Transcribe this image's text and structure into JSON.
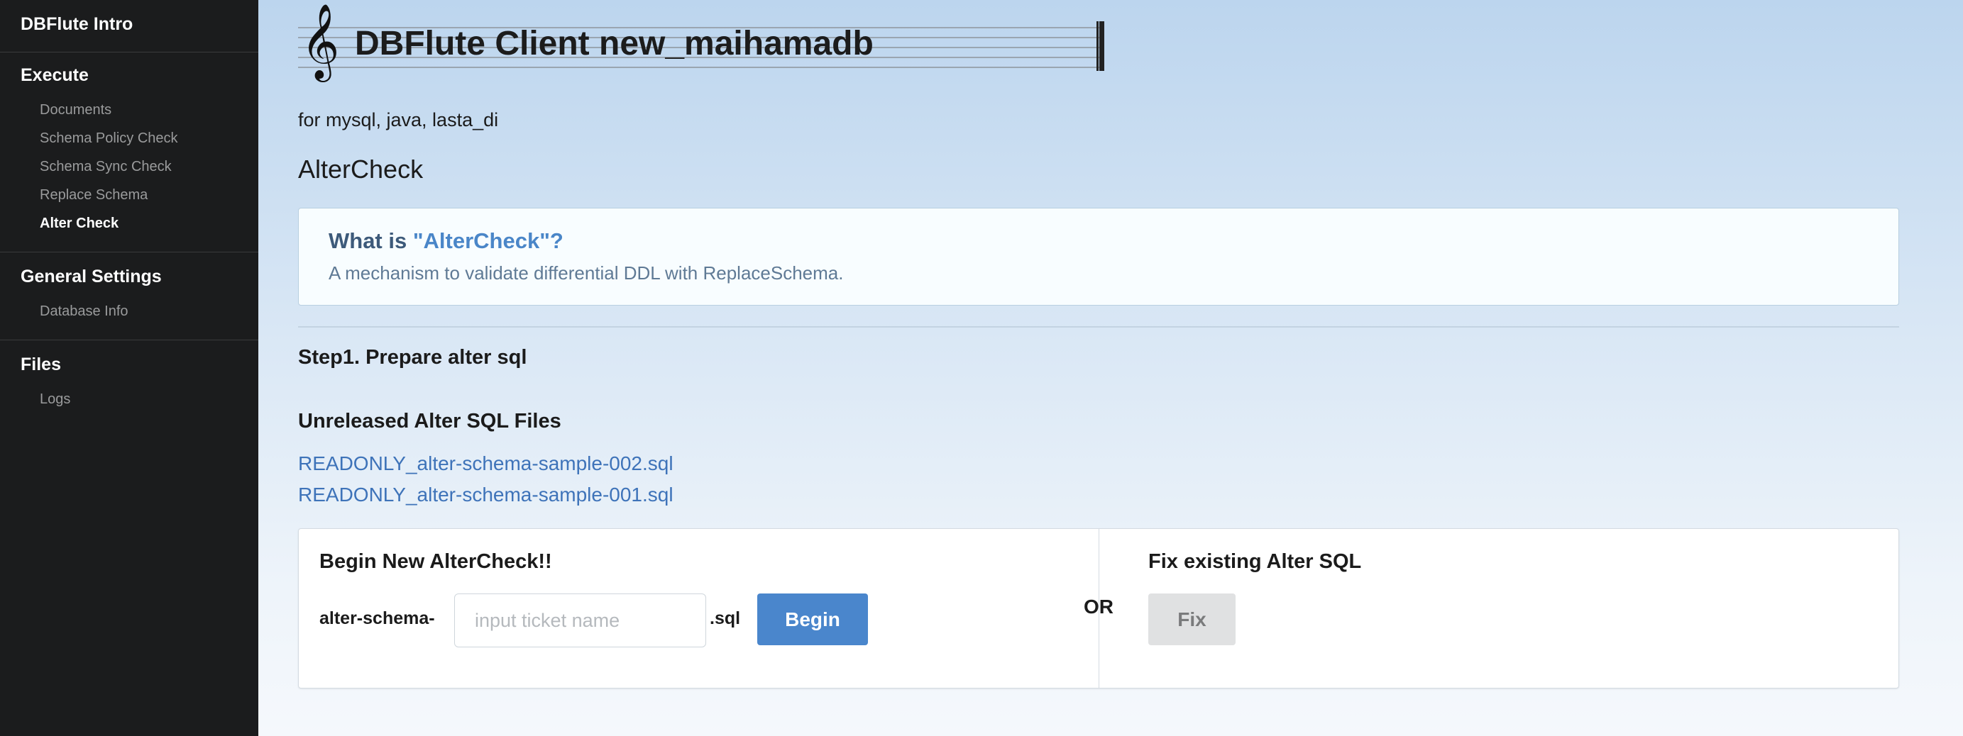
{
  "sidebar": {
    "title": "DBFlute Intro",
    "sections": [
      {
        "heading": "Execute",
        "items": [
          "Documents",
          "Schema Policy Check",
          "Schema Sync Check",
          "Replace Schema",
          "Alter Check"
        ]
      },
      {
        "heading": "General Settings",
        "items": [
          "Database Info"
        ]
      },
      {
        "heading": "Files",
        "items": [
          "Logs"
        ]
      }
    ],
    "active_item": "Alter Check"
  },
  "header": {
    "clef_icon": "treble-clef-icon",
    "title": "DBFlute Client new_maihamadb",
    "subtitle": "for mysql, java, lasta_di"
  },
  "main": {
    "section_title": "AlterCheck",
    "info": {
      "question_prefix": "What is ",
      "question_keyword": "\"AlterCheck\"?",
      "description": "A mechanism to validate differential DDL with ReplaceSchema."
    },
    "step_title": "Step1. Prepare alter sql",
    "files_title": "Unreleased Alter SQL Files",
    "files": [
      "READONLY_alter-schema-sample-002.sql",
      "READONLY_alter-schema-sample-001.sql"
    ],
    "begin": {
      "title": "Begin New AlterCheck!!",
      "prefix": "alter-schema-",
      "input_placeholder": "input ticket name",
      "input_value": "",
      "suffix": ".sql",
      "button_label": "Begin"
    },
    "or_label": "OR",
    "fix": {
      "title": "Fix existing Alter SQL",
      "button_label": "Fix"
    }
  },
  "colors": {
    "sidebar_bg": "#1b1c1d",
    "link": "#3e73b9",
    "primary_button": "#4a86cc",
    "disabled_button": "#e0e1e2"
  }
}
